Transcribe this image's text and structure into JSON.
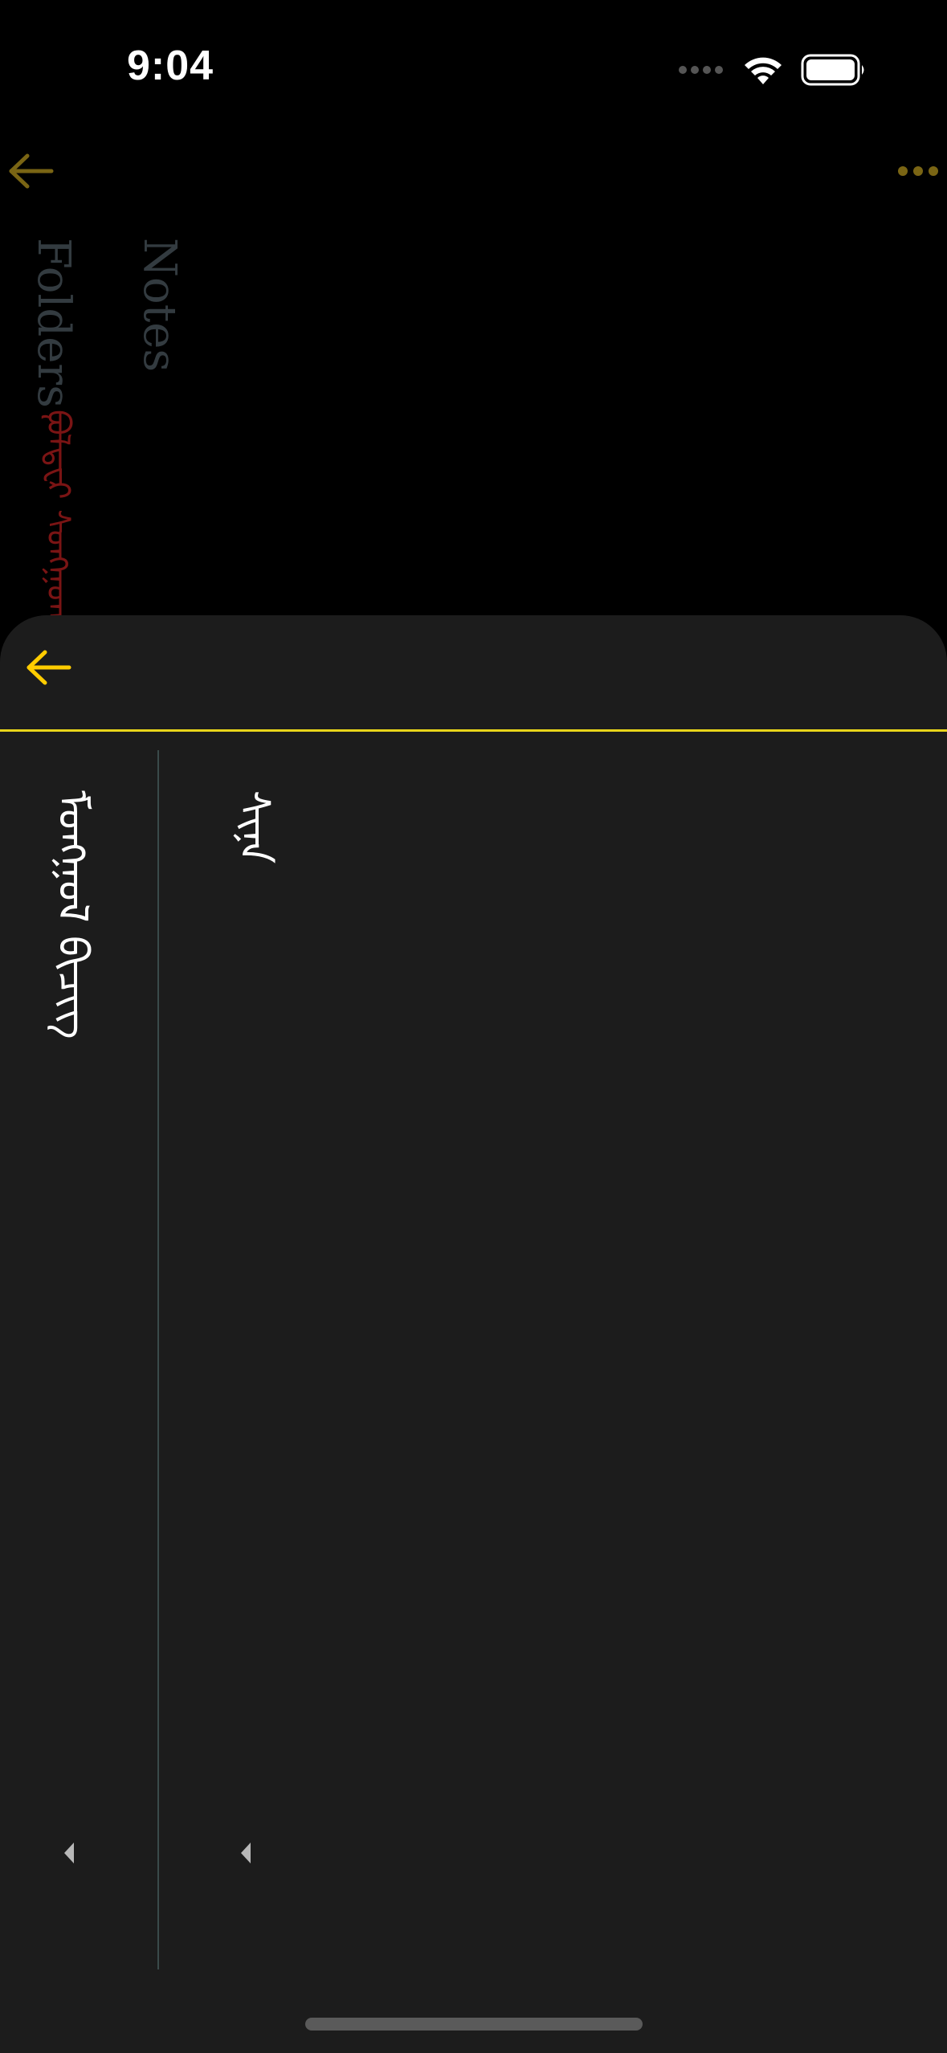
{
  "status_bar": {
    "time": "9:04"
  },
  "background_screen": {
    "back_icon": "arrow-left-icon",
    "more_icon": "ellipsis-icon",
    "folders_label": "Folders",
    "notes_label": "Notes",
    "mongolian_label": "ᠹᠣᠯᠳ᠋ᠧᠷ ᠰᠣᠩᠭᠣᠬᠤ"
  },
  "sheet": {
    "back_icon": "arrow-left-icon",
    "columns": [
      {
        "text": "ᠮᠣᠩᠭᠣᠯ ᠪᠢᠴᠢᠭ",
        "scroll_icon": "caret-left-icon"
      },
      {
        "text": "ᠰᠢᠨᠡ",
        "scroll_icon": "caret-left-icon"
      }
    ]
  },
  "colors": {
    "accent": "#FFCC00",
    "sheet_background": "#1C1C1C",
    "divider": "#E8D51A",
    "dim_label": "#333B40",
    "dim_red": "#7A1414"
  }
}
